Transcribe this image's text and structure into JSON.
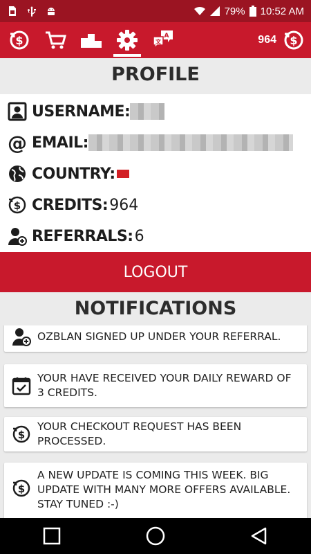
{
  "status_bar": {
    "battery": "79%",
    "time": "10:52 AM",
    "icons": [
      "sim-icon",
      "usb-icon",
      "android-icon",
      "wifi-icon",
      "signal-icon",
      "battery-icon"
    ]
  },
  "toolbar": {
    "tabs": [
      {
        "name": "credits-exchange",
        "icon": "dollar-cycle-icon"
      },
      {
        "name": "shop",
        "icon": "cart-icon"
      },
      {
        "name": "leaderboard",
        "icon": "podium-icon"
      },
      {
        "name": "settings",
        "icon": "gear-icon",
        "active": true
      },
      {
        "name": "chat",
        "icon": "chat-icon"
      }
    ],
    "balance": "964",
    "balance_icon": "dollar-cycle-icon"
  },
  "profile": {
    "title": "PROFILE",
    "username_label": "USERNAME:",
    "email_label": "EMAIL:",
    "country_label": "COUNTRY:",
    "credits_label": "CREDITS:",
    "credits_value": "964",
    "referrals_label": "REFERRALS:",
    "referrals_value": "6",
    "logout_label": "LOGOUT"
  },
  "notifications": {
    "title": "NOTIFICATIONS",
    "items": [
      {
        "icon": "add-user-icon",
        "text": "OZBLAN SIGNED UP UNDER YOUR REFERRAL."
      },
      {
        "icon": "calendar-check-icon",
        "text": "YOUR HAVE RECEIVED YOUR DAILY REWARD OF 3 CREDITS."
      },
      {
        "icon": "dollar-cycle-icon",
        "text": "YOUR CHECKOUT REQUEST HAS BEEN PROCESSED."
      },
      {
        "icon": "dollar-cycle-icon",
        "text": "A NEW UPDATE IS COMING THIS WEEK. BIG UPDATE WITH MANY MORE OFFERS AVAILABLE. STAY TUNED :-)"
      }
    ]
  },
  "colors": {
    "brand_red": "#c8192c",
    "status_red": "#9b1422",
    "background": "#ebebeb"
  }
}
